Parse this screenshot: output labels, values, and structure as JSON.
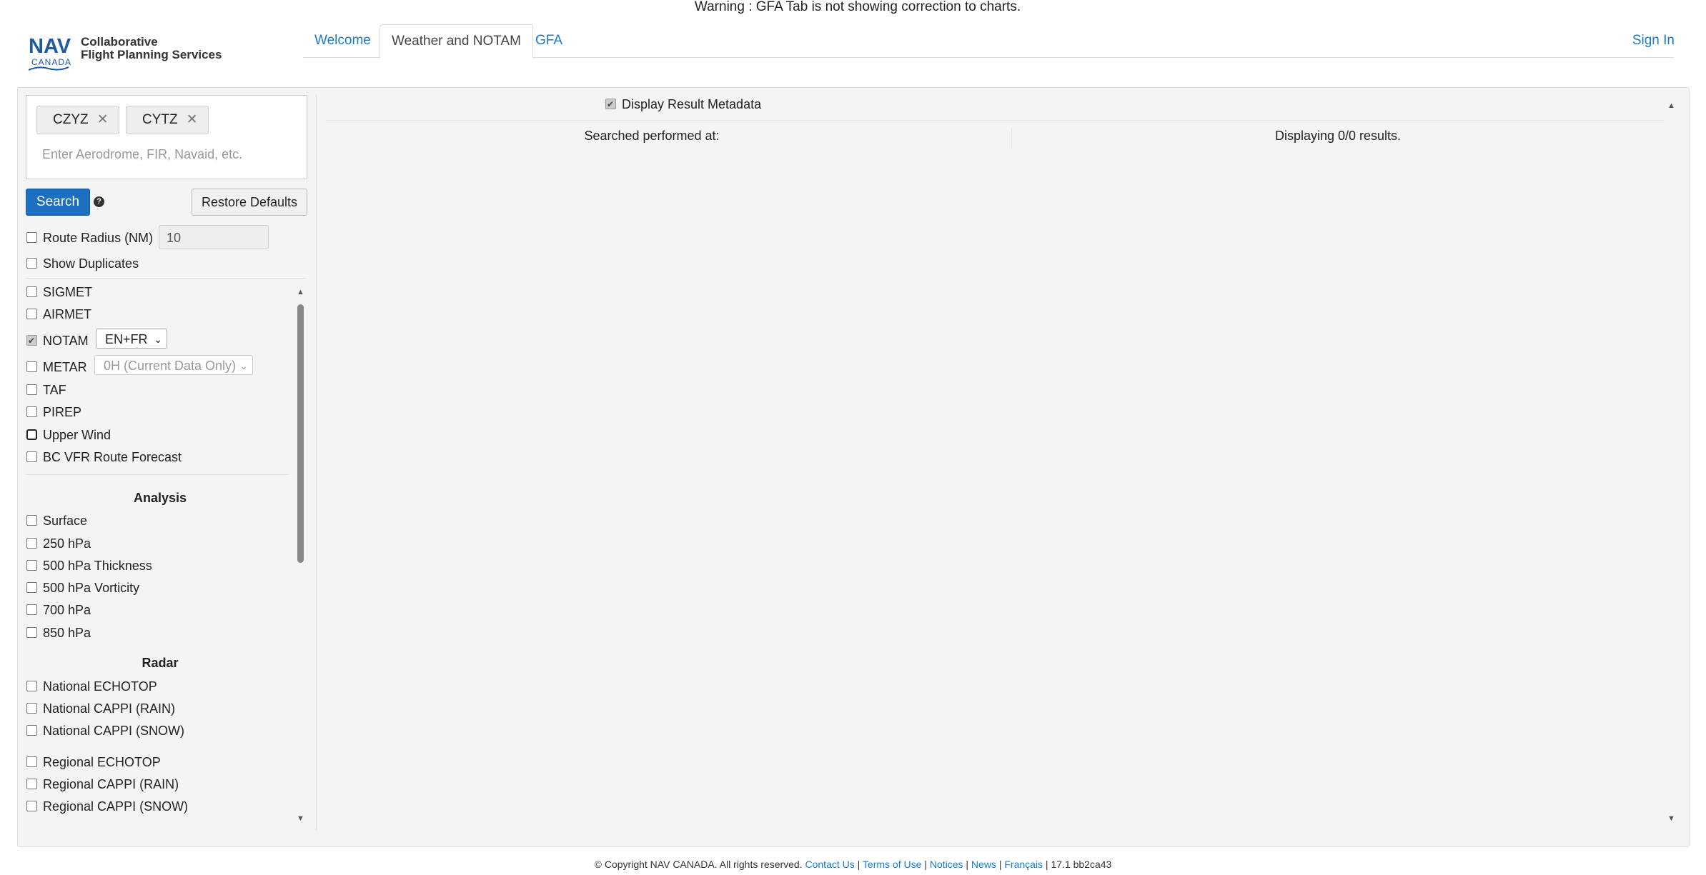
{
  "warning": "Warning : GFA Tab is not showing correction to charts.",
  "logo": {
    "nav": "NAV",
    "canada": "CANADA",
    "line1": "Collaborative",
    "line2": "Flight Planning Services"
  },
  "tabs": [
    {
      "label": "Welcome",
      "active": false
    },
    {
      "label": "Weather and NOTAM",
      "active": true
    },
    {
      "label": "GFA",
      "active": false
    }
  ],
  "sign_in": "Sign In",
  "search": {
    "chips": [
      "CZYZ",
      "CYTZ"
    ],
    "placeholder": "Enter Aerodrome, FIR, Navaid, etc.",
    "search_label": "Search",
    "help_icon": "?",
    "restore_label": "Restore Defaults"
  },
  "options": {
    "route_radius_label": "Route Radius (NM)",
    "route_radius_value": "10",
    "show_duplicates_label": "Show Duplicates"
  },
  "products": {
    "sigmet": "SIGMET",
    "airmet": "AIRMET",
    "notam": "NOTAM",
    "notam_lang": "EN+FR",
    "metar": "METAR",
    "metar_range": "0H (Current Data Only)",
    "taf": "TAF",
    "pirep": "PIREP",
    "upper_wind": "Upper Wind",
    "bc_vfr": "BC VFR Route Forecast"
  },
  "analysis": {
    "title": "Analysis",
    "items": [
      "Surface",
      "250 hPa",
      "500 hPa Thickness",
      "500 hPa Vorticity",
      "700 hPa",
      "850 hPa"
    ]
  },
  "radar": {
    "title": "Radar",
    "national": [
      "National ECHOTOP",
      "National CAPPI (RAIN)",
      "National CAPPI (SNOW)"
    ],
    "regional": [
      "Regional ECHOTOP",
      "Regional CAPPI (RAIN)",
      "Regional CAPPI (SNOW)"
    ]
  },
  "results": {
    "display_metadata": "Display Result Metadata",
    "searched_at": "Searched performed at:",
    "displaying": "Displaying 0/0 results."
  },
  "footer": {
    "copyright": "© Copyright NAV CANADA. All rights reserved.",
    "links": [
      "Contact Us",
      "Terms of Use",
      "Notices",
      "News",
      "Français"
    ],
    "version": "17.1 bb2ca43"
  }
}
